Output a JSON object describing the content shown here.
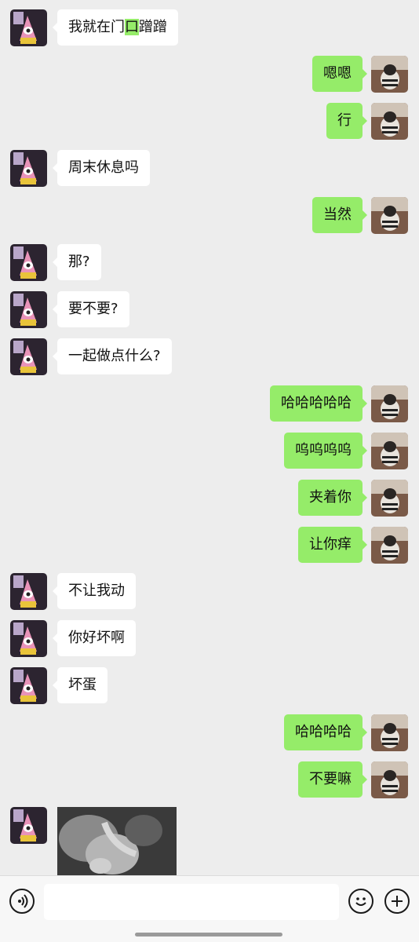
{
  "messages": [
    {
      "side": "left",
      "pre": "我就在门",
      "hl": "口",
      "post": "蹭蹭"
    },
    {
      "side": "right",
      "text": "嗯嗯"
    },
    {
      "side": "right",
      "text": "行"
    },
    {
      "side": "left",
      "text": "周末休息吗"
    },
    {
      "side": "right",
      "text": "当然"
    },
    {
      "side": "left",
      "text": "那?"
    },
    {
      "side": "left",
      "text": "要不要?"
    },
    {
      "side": "left",
      "text": "一起做点什么?"
    },
    {
      "side": "right",
      "text": "哈哈哈哈哈"
    },
    {
      "side": "right",
      "text": "呜呜呜呜"
    },
    {
      "side": "right",
      "text": "夹着你"
    },
    {
      "side": "right",
      "text": "让你痒"
    },
    {
      "side": "left",
      "text": "不让我动"
    },
    {
      "side": "left",
      "text": "你好坏啊"
    },
    {
      "side": "left",
      "text": "坏蛋"
    },
    {
      "side": "right",
      "text": "哈哈哈哈"
    },
    {
      "side": "right",
      "text": "不要嘛"
    },
    {
      "side": "left",
      "type": "image"
    }
  ],
  "colors": {
    "background": "#ededed",
    "sent_bubble": "#95ec69",
    "received_bubble": "#ffffff",
    "toolbar": "#f7f7f7"
  },
  "icons": {
    "voice": "voice-icon",
    "emoji": "emoji-icon",
    "plus": "plus-icon"
  }
}
